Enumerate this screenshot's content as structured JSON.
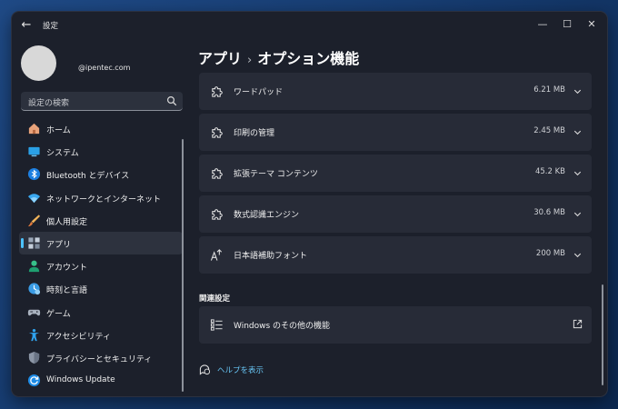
{
  "window": {
    "title": "設定",
    "back_glyph": "←",
    "minimize_glyph": "—",
    "maximize_glyph": "☐",
    "close_glyph": "✕"
  },
  "user": {
    "email": "@ipentec.com"
  },
  "search": {
    "placeholder": "設定の検索",
    "icon": "search-icon"
  },
  "sidebar": {
    "items": [
      {
        "label": "ホーム",
        "icon": "home-icon",
        "selected": false
      },
      {
        "label": "システム",
        "icon": "system-icon",
        "selected": false
      },
      {
        "label": "Bluetooth とデバイス",
        "icon": "bluetooth-icon",
        "selected": false
      },
      {
        "label": "ネットワークとインターネット",
        "icon": "network-icon",
        "selected": false
      },
      {
        "label": "個人用設定",
        "icon": "personalization-icon",
        "selected": false
      },
      {
        "label": "アプリ",
        "icon": "apps-icon",
        "selected": true
      },
      {
        "label": "アカウント",
        "icon": "account-icon",
        "selected": false
      },
      {
        "label": "時刻と言語",
        "icon": "time-language-icon",
        "selected": false
      },
      {
        "label": "ゲーム",
        "icon": "gaming-icon",
        "selected": false
      },
      {
        "label": "アクセシビリティ",
        "icon": "accessibility-icon",
        "selected": false
      },
      {
        "label": "プライバシーとセキュリティ",
        "icon": "privacy-icon",
        "selected": false
      },
      {
        "label": "Windows Update",
        "icon": "windows-update-icon",
        "selected": false
      }
    ]
  },
  "breadcrumb": {
    "parent": "アプリ",
    "separator": "›",
    "current": "オプション機能"
  },
  "features": [
    {
      "label": "ワードパッド",
      "size": "6.21 MB",
      "icon": "puzzle-icon"
    },
    {
      "label": "印刷の管理",
      "size": "2.45 MB",
      "icon": "puzzle-icon"
    },
    {
      "label": "拡張テーマ コンテンツ",
      "size": "45.2 KB",
      "icon": "puzzle-icon"
    },
    {
      "label": "数式認識エンジン",
      "size": "30.6 MB",
      "icon": "puzzle-icon"
    },
    {
      "label": "日本語補助フォント",
      "size": "200 MB",
      "icon": "font-icon"
    }
  ],
  "related": {
    "title": "関連設定",
    "other_features_label": "Windows のその他の機能"
  },
  "help": {
    "label": "ヘルプを表示"
  },
  "colors": {
    "accent": "#4cc2ff",
    "link": "#68c6f5",
    "card": "#272b37",
    "window": "#1c202b"
  }
}
